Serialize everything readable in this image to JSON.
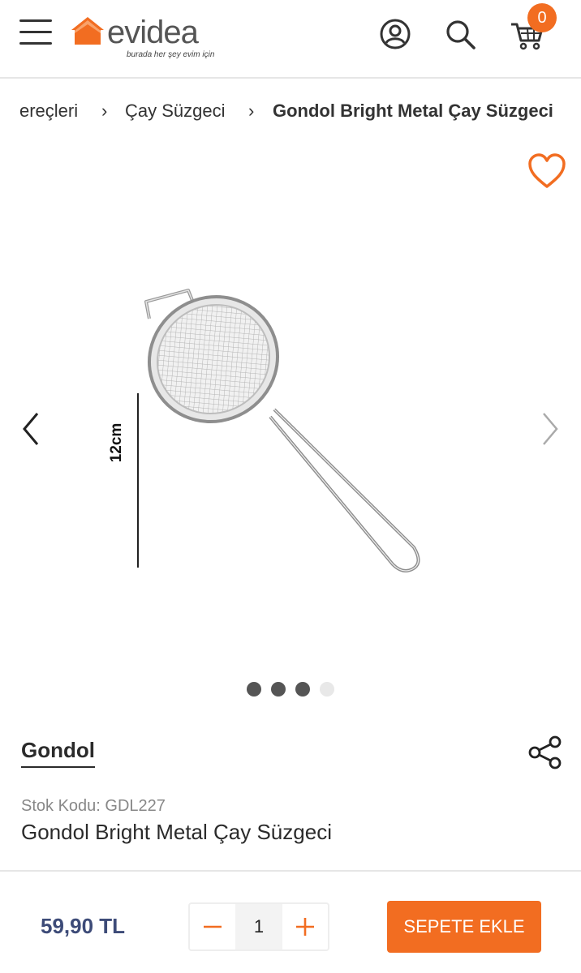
{
  "header": {
    "logo_text": "evidea",
    "logo_tagline": "burada her şey evim için",
    "cart_count": "0",
    "brand_color": "#f26d21",
    "icons": [
      "menu-icon",
      "user-icon",
      "search-icon",
      "cart-icon"
    ]
  },
  "breadcrumb": {
    "items": [
      "ereçleri",
      "Çay Süzgeci",
      "Gondol Bright Metal Çay Süzgeci"
    ],
    "separator": "›"
  },
  "gallery": {
    "dimension_label": "12cm",
    "total_images": 4,
    "active_index": 2,
    "icons": [
      "heart-icon",
      "chevron-left-icon",
      "chevron-right-icon"
    ]
  },
  "product": {
    "brand": "Gondol",
    "stock_label": "Stok Kodu:",
    "stock_code": "GDL227",
    "title": "Gondol Bright Metal Çay Süzgeci"
  },
  "purchase": {
    "price": "59,90 TL",
    "quantity": "1",
    "add_to_cart_label": "SEPETE EKLE",
    "price_color": "#3d4b78"
  }
}
